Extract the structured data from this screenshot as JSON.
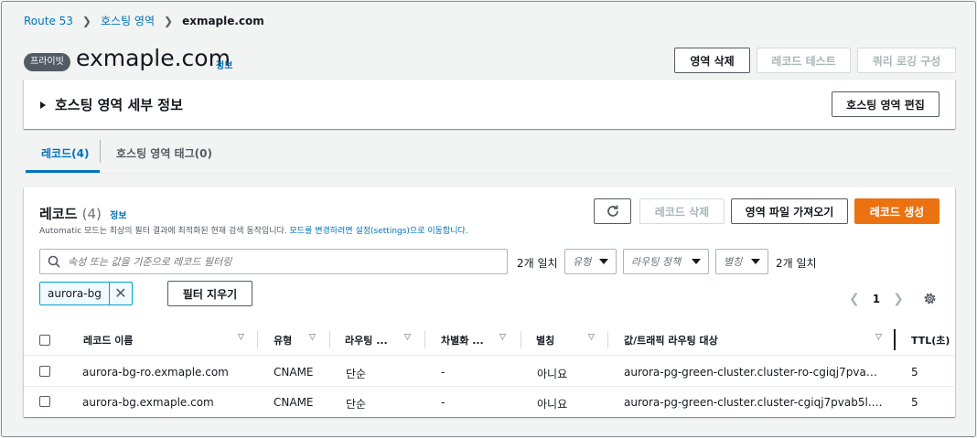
{
  "breadcrumb": {
    "items": [
      "Route 53",
      "호스팅 영역"
    ],
    "current": "exmaple.com"
  },
  "header": {
    "badge": "프라이빗",
    "title": "exmaple.com",
    "info": "정보",
    "buttons": {
      "delete_zone": "영역 삭제",
      "test_record": "레코드 테스트",
      "query_logging": "쿼리 로깅 구성"
    }
  },
  "details": {
    "title": "호스팅 영역 세부 정보",
    "edit_button": "호스팅 영역 편집"
  },
  "tabs": [
    {
      "label": "레코드(4)",
      "active": true
    },
    {
      "label": "호스팅 영역 태그(0)",
      "active": false
    }
  ],
  "records": {
    "title": "레코드",
    "count": "(4)",
    "info": "정보",
    "description": "Automatic 모드는 최상의 필터 결과에 최적화된 현재 검색 동작입니다. ",
    "description_link": "모드를 변경하려면 설정(settings)으로 이동합니다.",
    "buttons": {
      "delete": "레코드 삭제",
      "import": "영역 파일 가져오기",
      "create": "레코드 생성"
    },
    "search_placeholder": "속성 또는 값을 기준으로 레코드 필터링",
    "match_count_1": "2개 일치",
    "match_count_2": "2개 일치",
    "filters": {
      "type": "유형",
      "routing_policy": "라우팅 정책",
      "alias": "별칭"
    },
    "token": "aurora-bg",
    "clear_filters": "필터 지우기",
    "page": "1",
    "columns": [
      "레코드 이름",
      "유형",
      "라우팅 ...",
      "차별화 ...",
      "별칭",
      "값/트래픽 라우팅 대상",
      "TTL(초)"
    ],
    "rows": [
      {
        "name": "aurora-bg-ro.exmaple.com",
        "type": "CNAME",
        "routing": "단순",
        "differentiator": "-",
        "alias": "아니요",
        "value": "aurora-pg-green-cluster.cluster-ro-cgiqj7pvab5l...",
        "ttl": "5"
      },
      {
        "name": "aurora-bg.exmaple.com",
        "type": "CNAME",
        "routing": "단순",
        "differentiator": "-",
        "alias": "아니요",
        "value": "aurora-pg-green-cluster.cluster-cgiqj7pvab5l.ap...",
        "ttl": "5"
      }
    ]
  },
  "colors": {
    "link": "#0073bb",
    "primary": "#ec7211",
    "background": "#f2f3f3"
  },
  "icons": [
    "chevron-right-icon",
    "caret-right-icon",
    "refresh-icon",
    "search-icon",
    "caret-down-icon",
    "close-icon",
    "chevron-left-icon",
    "gear-icon",
    "sort-icon"
  ]
}
